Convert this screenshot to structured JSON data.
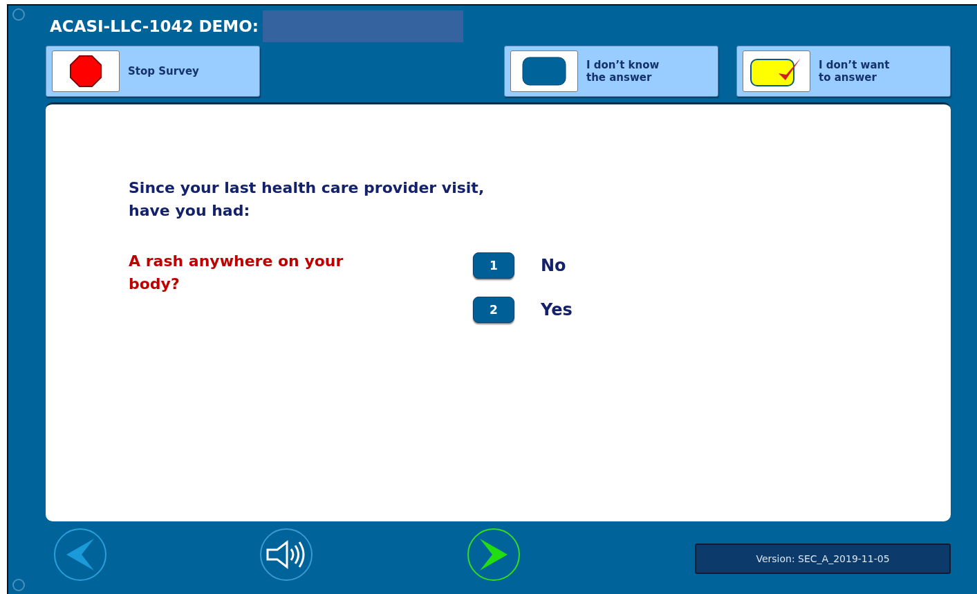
{
  "header": {
    "title": "ACASI-LLC-1042 DEMO:"
  },
  "toolbar": [
    {
      "kind": "stop",
      "label": "Stop Survey"
    },
    {
      "kind": "dont_know",
      "label": "I don’t know\nthe answer"
    },
    {
      "kind": "refuse",
      "label": "I don’t want\nto answer"
    }
  ],
  "question": {
    "stem": "Since your last health care provider visit, have you had:",
    "item": "A rash anywhere on your body?"
  },
  "options": [
    {
      "number": "1",
      "label": "No",
      "selected": false
    },
    {
      "number": "2",
      "label": "Yes",
      "selected": false
    }
  ],
  "footer": {
    "version": "Version: SEC_A_2019-11-05"
  }
}
